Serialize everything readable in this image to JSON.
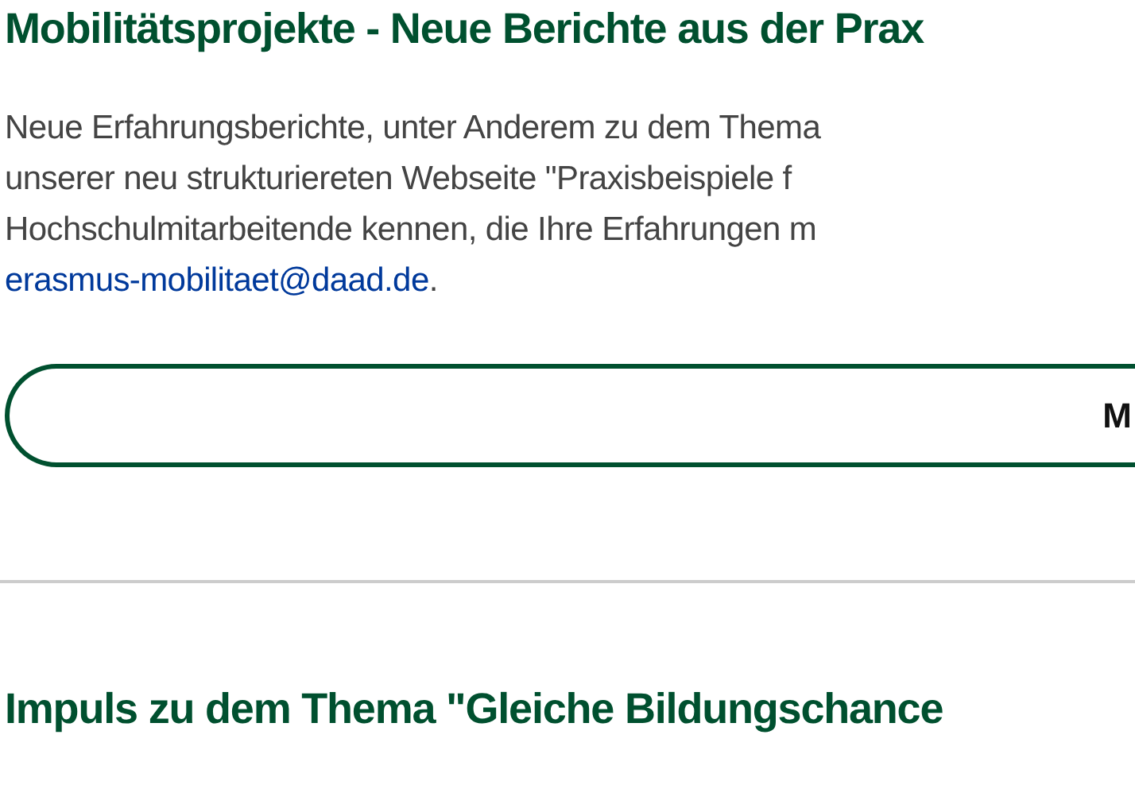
{
  "article": {
    "heading": "Mobilitätsprojekte - Neue Berichte aus der Prax",
    "paragraph_lines": [
      "Neue Erfahrungsberichte, unter Anderem zu dem Thema",
      "unserer neu strukturiereten Webseite \"Praxisbeispiele f",
      "Hochschulmitarbeitende kennen, die Ihre Erfahrungen m"
    ],
    "email_link": "erasmus-mobilitaet@daad.de",
    "after_link": ".",
    "button": "M"
  },
  "next_article": {
    "heading": "Impuls zu dem Thema \"Gleiche Bildungschance"
  }
}
